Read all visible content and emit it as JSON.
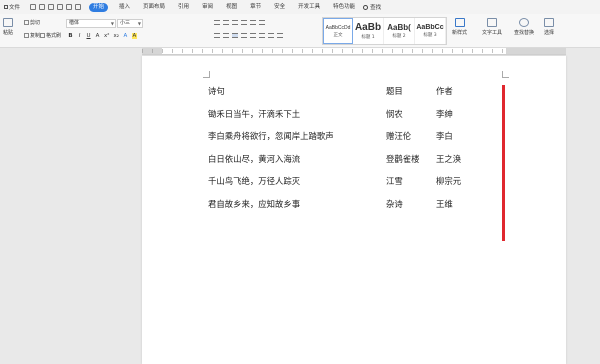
{
  "menubar": {
    "file_label": "文件",
    "tabs": [
      "开始",
      "插入",
      "页面布局",
      "引用",
      "审阅",
      "视图",
      "章节",
      "安全",
      "开发工具",
      "特色功能"
    ],
    "active_tab": "开始",
    "search_label": "查找"
  },
  "ribbon": {
    "paste_label": "粘贴",
    "cut_label": "剪切",
    "copy_label": "复制",
    "format_painter_label": "格式刷",
    "font_name": "楷体",
    "font_size": "小三",
    "format_buttons": [
      "B",
      "I",
      "U",
      "A",
      "x²",
      "x₂",
      "A",
      "A"
    ],
    "styles": [
      {
        "preview": "AaBbCcDd",
        "name": "正文"
      },
      {
        "preview": "AaBb",
        "name": "标题 1"
      },
      {
        "preview": "AaBb(",
        "name": "标题 2"
      },
      {
        "preview": "AaBbCc",
        "name": "标题 3"
      }
    ],
    "new_style_label": "新样式",
    "text_tools_label": "文字工具",
    "find_replace_label": "查找替换",
    "select_label": "选择"
  },
  "document": {
    "rows": [
      {
        "poem": "诗句",
        "title": "题目",
        "author": "作者"
      },
      {
        "poem": "锄禾日当午，汗滴禾下土",
        "title": "悯农",
        "author": "李绅"
      },
      {
        "poem": "李白乘舟将欲行，忽闻岸上踏歌声",
        "title": "赠汪伦",
        "author": "李白"
      },
      {
        "poem": "白日依山尽，黄河入海流",
        "title": "登鹳雀楼",
        "author": "王之涣"
      },
      {
        "poem": "千山鸟飞绝，万径人踪灭",
        "title": "江雪",
        "author": "柳宗元"
      },
      {
        "poem": "君自故乡来，应知故乡事",
        "title": "杂诗",
        "author": "王维"
      }
    ],
    "marker_color": "#e0282e"
  }
}
